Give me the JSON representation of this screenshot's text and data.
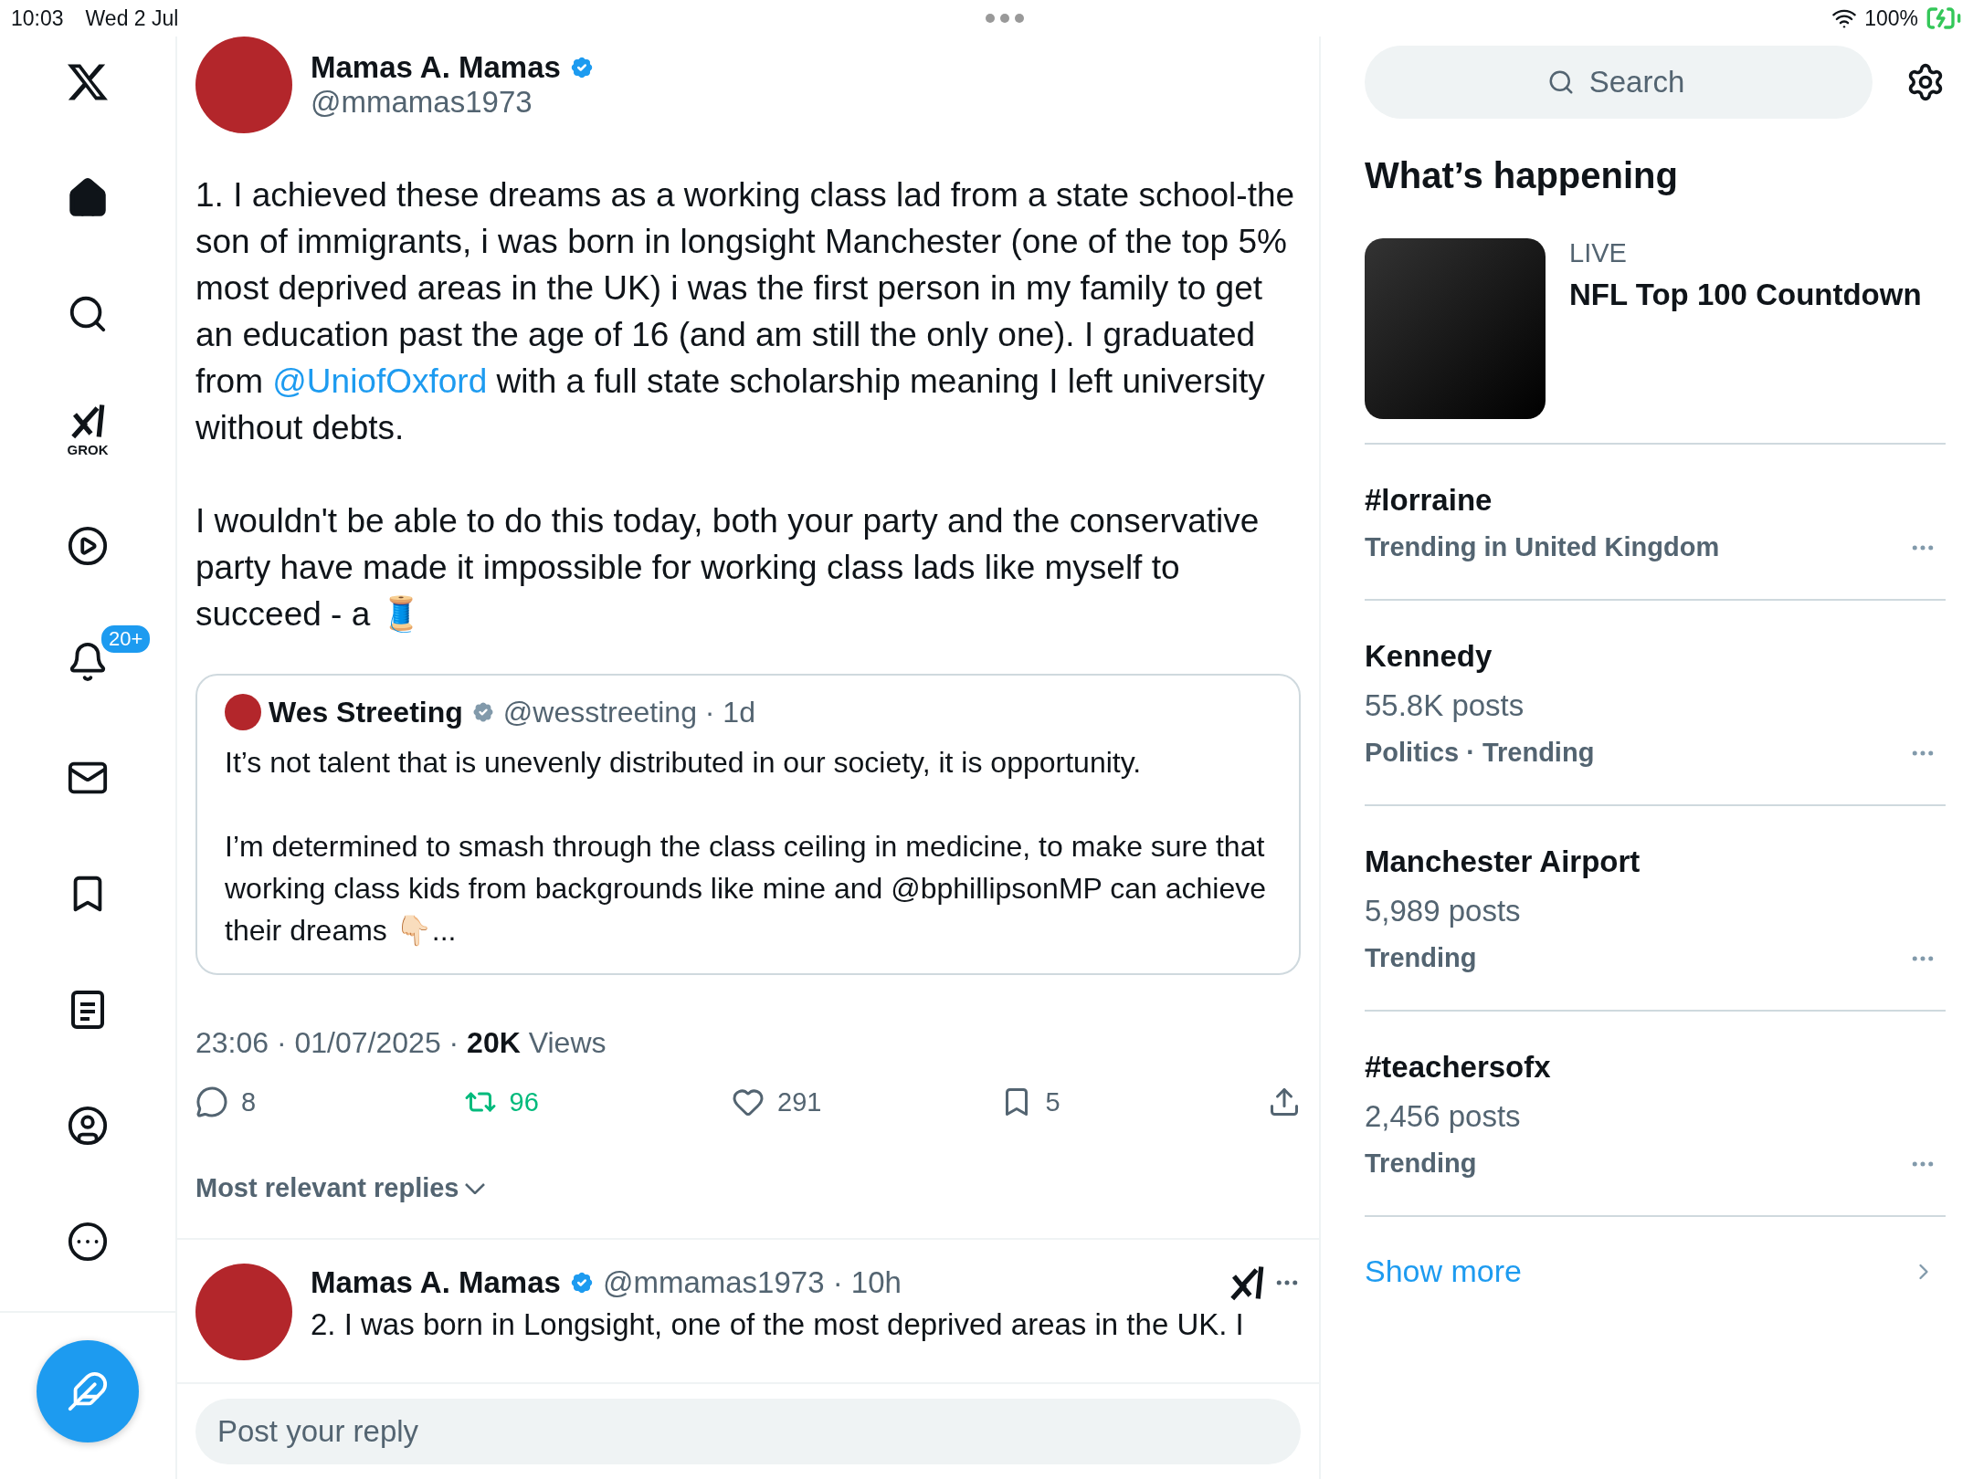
{
  "status_bar": {
    "time": "10:03",
    "date": "Wed 2 Jul",
    "battery": "100%",
    "charging": true
  },
  "sidebar": {
    "items": [
      {
        "kind": "home",
        "selected": true
      },
      {
        "kind": "search",
        "selected": false
      },
      {
        "kind": "grok",
        "label": "GROK",
        "selected": false
      },
      {
        "kind": "video",
        "selected": false
      },
      {
        "kind": "notifications",
        "badge": "20+",
        "selected": false
      },
      {
        "kind": "messages",
        "selected": false
      },
      {
        "kind": "bookmarks",
        "selected": false
      },
      {
        "kind": "lists",
        "selected": false
      },
      {
        "kind": "profile",
        "selected": false
      },
      {
        "kind": "more",
        "selected": false
      }
    ]
  },
  "tweet": {
    "author": "Mamas A. Mamas",
    "verified": true,
    "handle": "@mmamas1973",
    "paragraphs": [
      [
        {
          "kind": "text",
          "text": "1. I achieved these dreams as a working class lad from a state school-the son of immigrants, i was born in longsight Manchester (one of the top 5% most deprived areas in the UK) i was the first person in my family to get an education past the age of 16 (and am still the only one). I graduated from "
        },
        {
          "kind": "mention",
          "text": "@UniofOxford"
        },
        {
          "kind": "text",
          "text": " with a full state scholarship meaning I left university without debts."
        }
      ],
      [
        {
          "kind": "text",
          "text": "I wouldn't be able to do this today, both your party and the conservative party have made it impossible for working class lads like myself to succeed - a 🧵"
        }
      ]
    ],
    "quote": {
      "author": "Wes Streeting",
      "verified": true,
      "handle": "@wesstreeting · 1d",
      "paragraphs": [
        "It’s not talent that is unevenly distributed in our society, it is opportunity.",
        "I’m determined to smash through the class ceiling in medicine, to make sure that working class kids from backgrounds like mine and @bphillipsonMP can achieve their dreams 👇🏻..."
      ]
    },
    "meta": "23:06 · 01/07/2025 · **20K** Views",
    "actions": [
      {
        "kind": "reply",
        "count": "8",
        "active": false
      },
      {
        "kind": "repost",
        "count": "96",
        "active": true
      },
      {
        "kind": "like",
        "count": "291",
        "active": false
      },
      {
        "kind": "bookmark",
        "count": "5",
        "active": false
      },
      {
        "kind": "share",
        "active": false
      }
    ]
  },
  "replies_sort": "Most relevant replies",
  "reply": {
    "author": "Mamas A. Mamas",
    "verified": true,
    "handle": "@mmamas1973 · 10h",
    "text": "2. I was born in Longsight, one of the most deprived areas in the UK. I"
  },
  "reply_field": {
    "placeholder": "Post your reply"
  },
  "right": {
    "search": {
      "placeholder": "Search"
    },
    "heading": "What’s happening",
    "live": {
      "label": "LIVE",
      "title": "NFL Top 100 Countdown"
    },
    "trends": [
      {
        "title": "#lorraine",
        "meta": "Trending in United Kingdom"
      },
      {
        "title": "Kennedy",
        "posts": "55.8K posts",
        "meta": "Politics · Trending"
      },
      {
        "title": "Manchester Airport",
        "posts": "5,989 posts",
        "meta": "Trending"
      },
      {
        "title": "#teachersofx",
        "posts": "2,456 posts",
        "meta": "Trending"
      }
    ],
    "show_more": "Show more"
  }
}
